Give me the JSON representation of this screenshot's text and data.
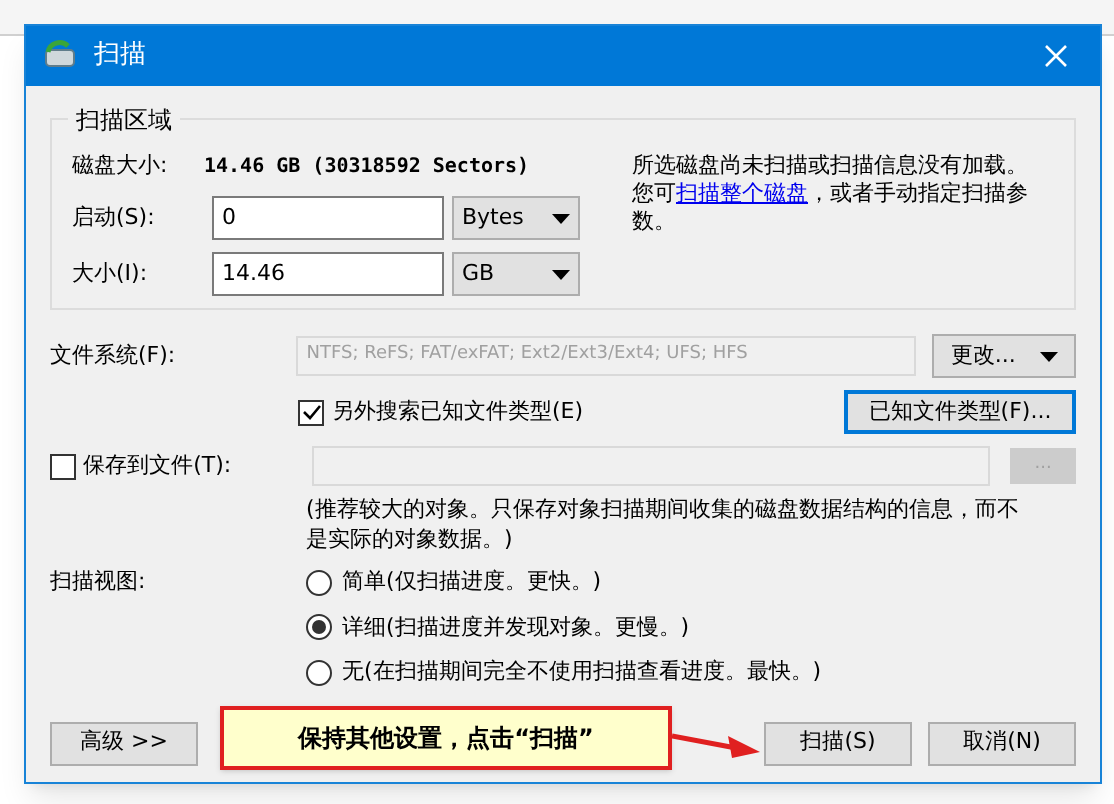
{
  "window": {
    "title": "扫描"
  },
  "scan_area": {
    "title": "扫描区域",
    "disk_size_label": "磁盘大小:",
    "disk_size_value": "14.46 GB (30318592 Sectors)",
    "info_text": "所选磁盘尚未扫描或扫描信息没有加载。",
    "info_prefix": "您可",
    "info_link": "扫描整个磁盘",
    "info_suffix": "，或者手动指定扫描参数。",
    "start": {
      "label": "启动(S):",
      "value": "0",
      "unit": "Bytes"
    },
    "size": {
      "label": "大小(I):",
      "value": "14.46",
      "unit": "GB"
    }
  },
  "file_system": {
    "label": "文件系统(F):",
    "value": "NTFS; ReFS; FAT/exFAT; Ext2/Ext3/Ext4; UFS; HFS",
    "change_button": "更改..."
  },
  "known_types": {
    "label": "另外搜索已知文件类型(E)",
    "checked": true,
    "button": "已知文件类型(F)..."
  },
  "save_to_file": {
    "label": "保存到文件(T):",
    "checked": false,
    "browse_button": "...",
    "note": "(推荐较大的对象。只保存对象扫描期间收集的磁盘数据结构的信息，而不是实际的对象数据。)"
  },
  "scan_view": {
    "label": "扫描视图:",
    "options": [
      {
        "label": "简单(仅扫描进度。更快。)",
        "selected": false
      },
      {
        "label": "详细(扫描进度并发现对象。更慢。)",
        "selected": true
      },
      {
        "label": "无(在扫描期间完全不使用扫描查看进度。最快。)",
        "selected": false
      }
    ]
  },
  "buttons": {
    "advanced": "高级 >>",
    "scan": "扫描(S)",
    "cancel": "取消(N)"
  },
  "callout": {
    "text": "保持其他设置，点击“扫描”"
  }
}
